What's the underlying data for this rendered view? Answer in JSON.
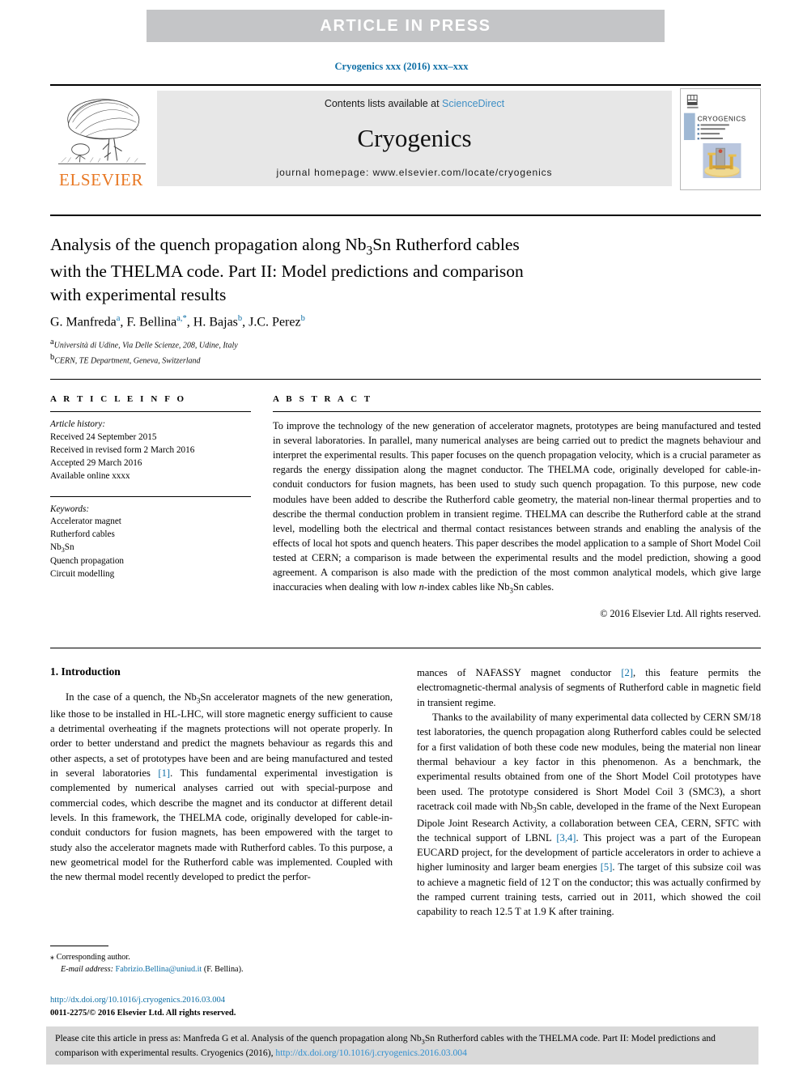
{
  "banner": {
    "label": "ARTICLE  IN  PRESS"
  },
  "journal_ref": "Cryogenics xxx (2016) xxx–xxx",
  "masthead": {
    "publisher": "ELSEVIER",
    "contents_prefix": "Contents lists available at ",
    "contents_link": "ScienceDirect",
    "journal_title": "Cryogenics",
    "homepage": "journal homepage: www.elsevier.com/locate/cryogenics",
    "cover_journal_name": "CRYOGENICS"
  },
  "article": {
    "title_line1": "Analysis of the quench propagation along Nb3Sn Rutherford cables",
    "title_line2": "with the THELMA code. Part II: Model predictions and comparison",
    "title_line3": "with experimental results",
    "authors": [
      {
        "name": "G. Manfreda",
        "marks": "a"
      },
      {
        "name": "F. Bellina",
        "marks": "a,*"
      },
      {
        "name": "H. Bajas",
        "marks": "b"
      },
      {
        "name": "J.C. Perez",
        "marks": "b"
      }
    ],
    "affiliations": [
      {
        "mark": "a",
        "text": "Università di Udine, Via Delle Scienze, 208, Udine, Italy"
      },
      {
        "mark": "b",
        "text": "CERN, TE Department, Geneva, Switzerland"
      }
    ]
  },
  "article_info": {
    "heading": "A R T I C L E    I N F O",
    "history_label": "Article history:",
    "history": [
      "Received 24 September 2015",
      "Received in revised form 2 March 2016",
      "Accepted 29 March 2016",
      "Available online xxxx"
    ],
    "keywords_label": "Keywords:",
    "keywords": [
      "Accelerator magnet",
      "Rutherford cables",
      "Nb3Sn",
      "Quench propagation",
      "Circuit modelling"
    ]
  },
  "abstract": {
    "heading": "A B S T R A C T",
    "text": "To improve the technology of the new generation of accelerator magnets, prototypes are being manufactured and tested in several laboratories. In parallel, many numerical analyses are being carried out to predict the magnets behaviour and interpret the experimental results. This paper focuses on the quench propagation velocity, which is a crucial parameter as regards the energy dissipation along the magnet conductor. The THELMA code, originally developed for cable-in-conduit conductors for fusion magnets, has been used to study such quench propagation. To this purpose, new code modules have been added to describe the Rutherford cable geometry, the material non-linear thermal properties and to describe the thermal conduction problem in transient regime. THELMA can describe the Rutherford cable at the strand level, modelling both the electrical and thermal contact resistances between strands and enabling the analysis of the effects of local hot spots and quench heaters. This paper describes the model application to a sample of Short Model Coil tested at CERN; a comparison is made between the experimental results and the model prediction, showing a good agreement. A comparison is also made with the prediction of the most common analytical models, which give large inaccuracies when dealing with low n-index cables like Nb3Sn cables.",
    "copyright": "© 2016 Elsevier Ltd. All rights reserved."
  },
  "section": {
    "title": "1. Introduction",
    "left_paragraph": "In the case of a quench, the Nb3Sn accelerator magnets of the new generation, like those to be installed in HL-LHC, will store magnetic energy sufficient to cause a detrimental overheating if the magnets protections will not operate properly. In order to better understand and predict the magnets behaviour as regards this and other aspects, a set of prototypes have been and are being manufactured and tested in several laboratories [1]. This fundamental experimental investigation is complemented by numerical analyses carried out with special-purpose and commercial codes, which describe the magnet and its conductor at different detail levels. In this framework, the THELMA code, originally developed for cable-in-conduit conductors for fusion magnets, has been empowered with the target to study also the accelerator magnets made with Rutherford cables. To this purpose, a new geometrical model for the Rutherford cable was implemented. Coupled with the new thermal model recently developed to predict the perfor-",
    "right_paragraph_1": "mances of NAFASSY magnet conductor [2], this feature permits the electromagnetic-thermal analysis of segments of Rutherford cable in magnetic field in transient regime.",
    "right_paragraph_2": "Thanks to the availability of many experimental data collected by CERN SM/18 test laboratories, the quench propagation along Rutherford cables could be selected for a first validation of both these code new modules, being the material non linear thermal behaviour a key factor in this phenomenon. As a benchmark, the experimental results obtained from one of the Short Model Coil prototypes have been used. The prototype considered is Short Model Coil 3 (SMC3), a short racetrack coil made with Nb3Sn cable, developed in the frame of the Next European Dipole Joint Research Activity, a collaboration between CEA, CERN, SFTC with the technical support of LBNL [3,4]. This project was a part of the European EUCARD project, for the development of particle accelerators in order to achieve a higher luminosity and larger beam energies [5]. The target of this subsize coil was to achieve a magnetic field of 12 T on the conductor; this was actually confirmed by the ramped current training tests, carried out in 2011, which showed the coil capability to reach 12.5 T at 1.9 K after training.",
    "refs": {
      "r1": "[1]",
      "r2": "[2]",
      "r34": "[3,4]",
      "r5": "[5]"
    }
  },
  "footnote": {
    "corresponding_mark": "⁎",
    "corresponding_text": "Corresponding author.",
    "email_label": "E-mail address:",
    "email": "Fabrizio.Bellina@uniud.it",
    "email_owner": "(F. Bellina)."
  },
  "doi_block": {
    "doi_url": "http://dx.doi.org/10.1016/j.cryogenics.2016.03.004",
    "issn_line": "0011-2275/© 2016 Elsevier Ltd. All rights reserved."
  },
  "cite_box": {
    "text_1": "Please cite this article in press as: Manfreda G et al. Analysis of the quench propagation along Nb3Sn Rutherford cables with the THELMA code. Part II:",
    "text_2": "Model predictions and comparison with experimental results. Cryogenics (2016), ",
    "link": "http://dx.doi.org/10.1016/j.cryogenics.2016.03.004"
  },
  "colors": {
    "banner_bg": "#c4c5c7",
    "link_blue": "#0f6fa6",
    "sciencedirect_blue": "#3f8fc5",
    "elsevier_orange": "#e87722",
    "band_gray": "#e7e7e7",
    "cite_gray": "#d9d9d9"
  }
}
